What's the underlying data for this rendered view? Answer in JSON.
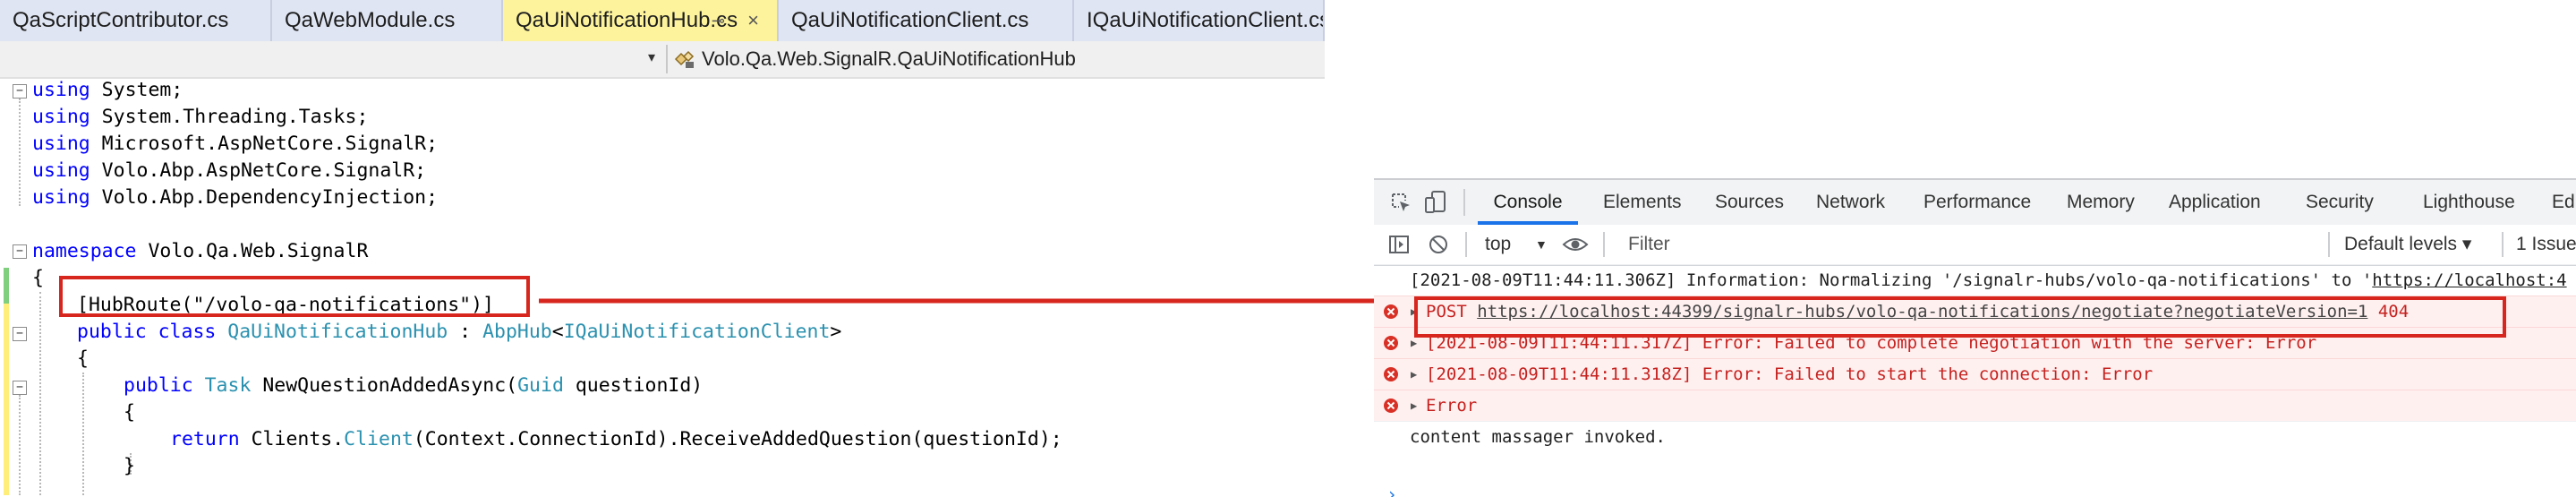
{
  "editor": {
    "tabs": [
      {
        "label": "QaScriptContributor.cs",
        "active": false
      },
      {
        "label": "QaWebModule.cs",
        "active": false
      },
      {
        "label": "QaUiNotificationHub.cs",
        "active": true,
        "pin_glyph": "⊸",
        "close_glyph": "×"
      },
      {
        "label": "QaUiNotificationClient.cs",
        "active": false
      },
      {
        "label": "IQaUiNotificationClient.cs",
        "active": false
      }
    ],
    "navbar": {
      "member": "Volo.Qa.Web.SignalR.QaUiNotificationHub",
      "dropdown_glyph": "▾"
    },
    "code_lines": [
      [
        "using",
        " System;"
      ],
      [
        "using",
        " System.Threading.Tasks;"
      ],
      [
        "using",
        " Microsoft.AspNetCore.SignalR;"
      ],
      [
        "using",
        " Volo.Abp.AspNetCore.SignalR;"
      ],
      [
        "using",
        " Volo.Abp.DependencyInjection;"
      ],
      [
        "namespace",
        " Volo.Qa.Web.SignalR"
      ],
      [
        "{"
      ],
      [
        "[HubRoute(\"/volo-qa-notifications\")]"
      ],
      [
        "public class ",
        "QaUiNotificationHub",
        " : ",
        "AbpHub",
        "<",
        "IQaUiNotificationClient",
        ">"
      ],
      [
        "{"
      ],
      [
        "public ",
        "Task",
        " NewQuestionAddedAsync(",
        "Guid",
        " questionId)"
      ],
      [
        "{"
      ],
      [
        "return ",
        "Clients",
        ".",
        "Client",
        "(Context.ConnectionId).ReceiveAddedQuestion(questionId);"
      ],
      [
        "}"
      ]
    ],
    "fold_glyph": "−",
    "colors": {
      "keyword": "#0000ff",
      "type": "#2b91af",
      "highlight": "#d7261e",
      "active_tab": "#fdf39c"
    }
  },
  "devtools": {
    "tabs": [
      "Console",
      "Elements",
      "Sources",
      "Network",
      "Performance",
      "Memory",
      "Application",
      "Security",
      "Lighthouse",
      "Edi"
    ],
    "active_tab": "Console",
    "toolbar": {
      "context": "top",
      "context_glyph": "▼",
      "filter_placeholder": "Filter",
      "levels": "Default levels ▾",
      "issues": "1 Issue"
    },
    "messages": [
      {
        "level": "info",
        "text": "[2021-08-09T11:44:11.306Z] Information: Normalizing '/signalr-hubs/volo-qa-notifications' to '",
        "link": "https://localhost:4"
      },
      {
        "level": "error",
        "prefix": "POST ",
        "link": "https://localhost:44399/signalr-hubs/volo-qa-notifications/negotiate?negotiateVersion=1",
        "suffix": " 404"
      },
      {
        "level": "error",
        "text": "[2021-08-09T11:44:11.317Z] Error: Failed to complete negotiation with the server: Error"
      },
      {
        "level": "error",
        "text": "[2021-08-09T11:44:11.318Z] Error: Failed to start the connection: Error"
      },
      {
        "level": "error",
        "text": "Error"
      },
      {
        "level": "info",
        "text": "content massager invoked."
      }
    ],
    "prompt_glyph": "›",
    "expand_glyph": "▶"
  }
}
